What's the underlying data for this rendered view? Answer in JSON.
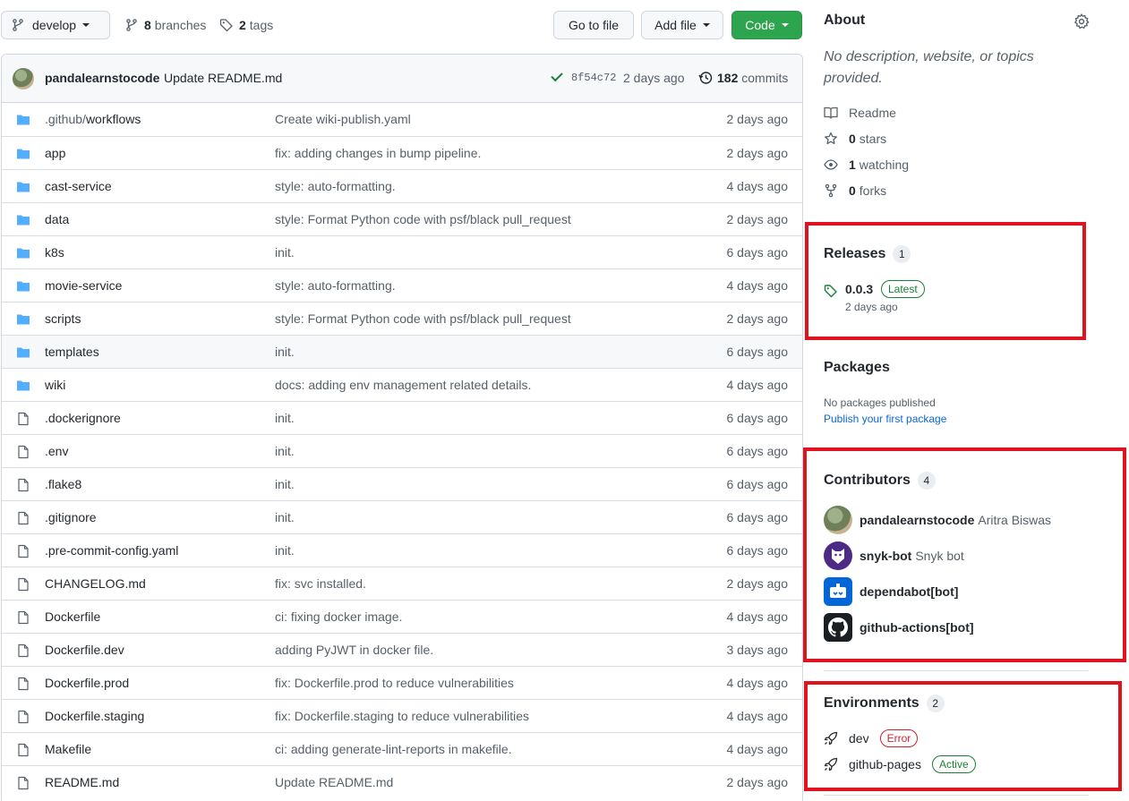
{
  "toolbar": {
    "branch": "develop",
    "branches_count": "8",
    "branches_label": "branches",
    "tags_count": "2",
    "tags_label": "tags",
    "goto_label": "Go to file",
    "add_label": "Add file",
    "code_label": "Code"
  },
  "commit": {
    "author": "pandalearnstocode",
    "message": "Update README.md",
    "sha": "8f54c72",
    "age": "2 days ago",
    "count": "182",
    "count_label": "commits"
  },
  "files": [
    {
      "type": "dir",
      "prefix": ".github/",
      "name": "workflows",
      "message": "Create wiki-publish.yaml",
      "age": "2 days ago"
    },
    {
      "type": "dir",
      "prefix": "",
      "name": "app",
      "message": "fix: adding changes in bump pipeline.",
      "age": "2 days ago"
    },
    {
      "type": "dir",
      "prefix": "",
      "name": "cast-service",
      "message": "style: auto-formatting.",
      "age": "4 days ago"
    },
    {
      "type": "dir",
      "prefix": "",
      "name": "data",
      "message": "style: Format Python code with psf/black pull_request",
      "age": "2 days ago"
    },
    {
      "type": "dir",
      "prefix": "",
      "name": "k8s",
      "message": "init.",
      "age": "6 days ago"
    },
    {
      "type": "dir",
      "prefix": "",
      "name": "movie-service",
      "message": "style: auto-formatting.",
      "age": "4 days ago"
    },
    {
      "type": "dir",
      "prefix": "",
      "name": "scripts",
      "message": "style: Format Python code with psf/black pull_request",
      "age": "2 days ago"
    },
    {
      "type": "dir",
      "prefix": "",
      "name": "templates",
      "message": "init.",
      "age": "6 days ago"
    },
    {
      "type": "dir",
      "prefix": "",
      "name": "wiki",
      "message": "docs: adding env management related details.",
      "age": "4 days ago"
    },
    {
      "type": "file",
      "prefix": "",
      "name": ".dockerignore",
      "message": "init.",
      "age": "6 days ago"
    },
    {
      "type": "file",
      "prefix": "",
      "name": ".env",
      "message": "init.",
      "age": "6 days ago"
    },
    {
      "type": "file",
      "prefix": "",
      "name": ".flake8",
      "message": "init.",
      "age": "6 days ago"
    },
    {
      "type": "file",
      "prefix": "",
      "name": ".gitignore",
      "message": "init.",
      "age": "6 days ago"
    },
    {
      "type": "file",
      "prefix": "",
      "name": ".pre-commit-config.yaml",
      "message": "init.",
      "age": "6 days ago"
    },
    {
      "type": "file",
      "prefix": "",
      "name": "CHANGELOG.md",
      "message": "fix: svc installed.",
      "age": "2 days ago"
    },
    {
      "type": "file",
      "prefix": "",
      "name": "Dockerfile",
      "message": "ci: fixing docker image.",
      "age": "4 days ago"
    },
    {
      "type": "file",
      "prefix": "",
      "name": "Dockerfile.dev",
      "message": "adding PyJWT in docker file.",
      "age": "3 days ago"
    },
    {
      "type": "file",
      "prefix": "",
      "name": "Dockerfile.prod",
      "message": "fix: Dockerfile.prod to reduce vulnerabilities",
      "age": "4 days ago"
    },
    {
      "type": "file",
      "prefix": "",
      "name": "Dockerfile.staging",
      "message": "fix: Dockerfile.staging to reduce vulnerabilities",
      "age": "4 days ago"
    },
    {
      "type": "file",
      "prefix": "",
      "name": "Makefile",
      "message": "ci: adding generate-lint-reports in makefile.",
      "age": "4 days ago"
    },
    {
      "type": "file",
      "prefix": "",
      "name": "README.md",
      "message": "Update README.md",
      "age": "2 days ago"
    }
  ],
  "about": {
    "title": "About",
    "description": "No description, website, or topics provided.",
    "readme": "Readme",
    "stars_count": "0",
    "stars_label": "stars",
    "watching_count": "1",
    "watching_label": "watching",
    "forks_count": "0",
    "forks_label": "forks"
  },
  "releases": {
    "title": "Releases",
    "count": "1",
    "version": "0.0.3",
    "badge": "Latest",
    "date": "2 days ago"
  },
  "packages": {
    "title": "Packages",
    "none_text": "No packages published",
    "link": "Publish your first package"
  },
  "contributors": {
    "title": "Contributors",
    "count": "4",
    "list": [
      {
        "login": "pandalearnstocode",
        "name": "Aritra Biswas"
      },
      {
        "login": "snyk-bot",
        "name": "Snyk bot"
      },
      {
        "login": "dependabot[bot]",
        "name": ""
      },
      {
        "login": "github-actions[bot]",
        "name": ""
      }
    ]
  },
  "environments": {
    "title": "Environments",
    "count": "2",
    "list": [
      {
        "name": "dev",
        "status": "Error"
      },
      {
        "name": "github-pages",
        "status": "Active"
      }
    ]
  },
  "colors": {
    "accent_green": "#2da44e",
    "link_blue": "#0969da",
    "folder_blue": "#54aeff",
    "highlight_red": "#e0141e"
  }
}
